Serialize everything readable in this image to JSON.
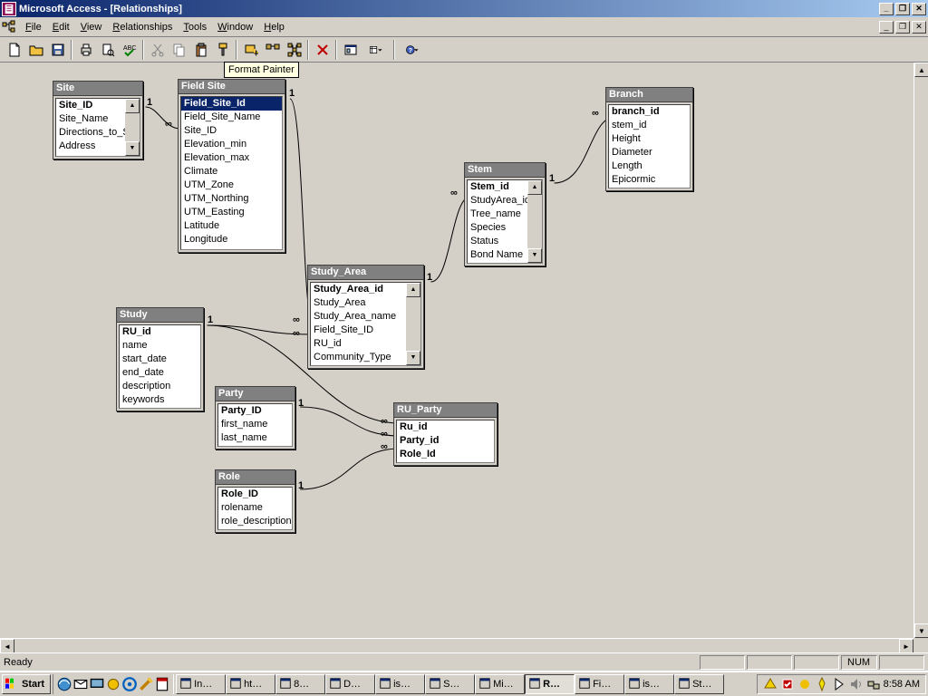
{
  "titlebar": {
    "text": "Microsoft Access - [Relationships]"
  },
  "menus": {
    "file": "File",
    "edit": "Edit",
    "view": "View",
    "relationships": "Relationships",
    "tools": "Tools",
    "window": "Window",
    "help": "Help"
  },
  "tooltip": "Format Painter",
  "tables": {
    "site": {
      "title": "Site",
      "fields": [
        "Site_ID",
        "Site_Name",
        "Directions_to_Site",
        "Address"
      ],
      "pk": [
        0
      ]
    },
    "fieldsite": {
      "title": "Field Site",
      "fields": [
        "Field_Site_Id",
        "Field_Site_Name",
        "Site_ID",
        "Elevation_min",
        "Elevation_max",
        "Climate",
        "UTM_Zone",
        "UTM_Northing",
        "UTM_Easting",
        "Latitude",
        "Longitude"
      ],
      "pk": [
        0
      ],
      "sel": 0
    },
    "study": {
      "title": "Study",
      "fields": [
        "RU_id",
        "name",
        "start_date",
        "end_date",
        "description",
        "keywords"
      ],
      "pk": [
        0
      ]
    },
    "studyarea": {
      "title": "Study_Area",
      "fields": [
        "Study_Area_id",
        "Study_Area",
        "Study_Area_name",
        "Field_Site_ID",
        "RU_id",
        "Community_Type"
      ],
      "pk": [
        0
      ]
    },
    "party": {
      "title": "Party",
      "fields": [
        "Party_ID",
        "first_name",
        "last_name"
      ],
      "pk": [
        0
      ]
    },
    "role": {
      "title": "Role",
      "fields": [
        "Role_ID",
        "rolename",
        "role_description"
      ],
      "pk": [
        0
      ]
    },
    "ruparty": {
      "title": "RU_Party",
      "fields": [
        "Ru_id",
        "Party_id",
        "Role_Id"
      ],
      "pk": [
        0,
        1,
        2
      ]
    },
    "stem": {
      "title": "Stem",
      "fields": [
        "Stem_id",
        "StudyArea_id",
        "Tree_name",
        "Species",
        "Status",
        "Bond Name"
      ],
      "pk": [
        0
      ]
    },
    "branch": {
      "title": "Branch",
      "fields": [
        "branch_id",
        "stem_id",
        "Height",
        "Diameter",
        "Length",
        "Epicormic"
      ],
      "pk": [
        0
      ]
    }
  },
  "status": {
    "ready": "Ready",
    "num": "NUM"
  },
  "taskbar": {
    "start": "Start",
    "items": [
      "In…",
      "ht…",
      "8…",
      "D…",
      "is…",
      "S…",
      "Mi…",
      "R…",
      "Fi…",
      "is…",
      "St…"
    ],
    "active_index": 7,
    "clock": "8:58 AM"
  }
}
